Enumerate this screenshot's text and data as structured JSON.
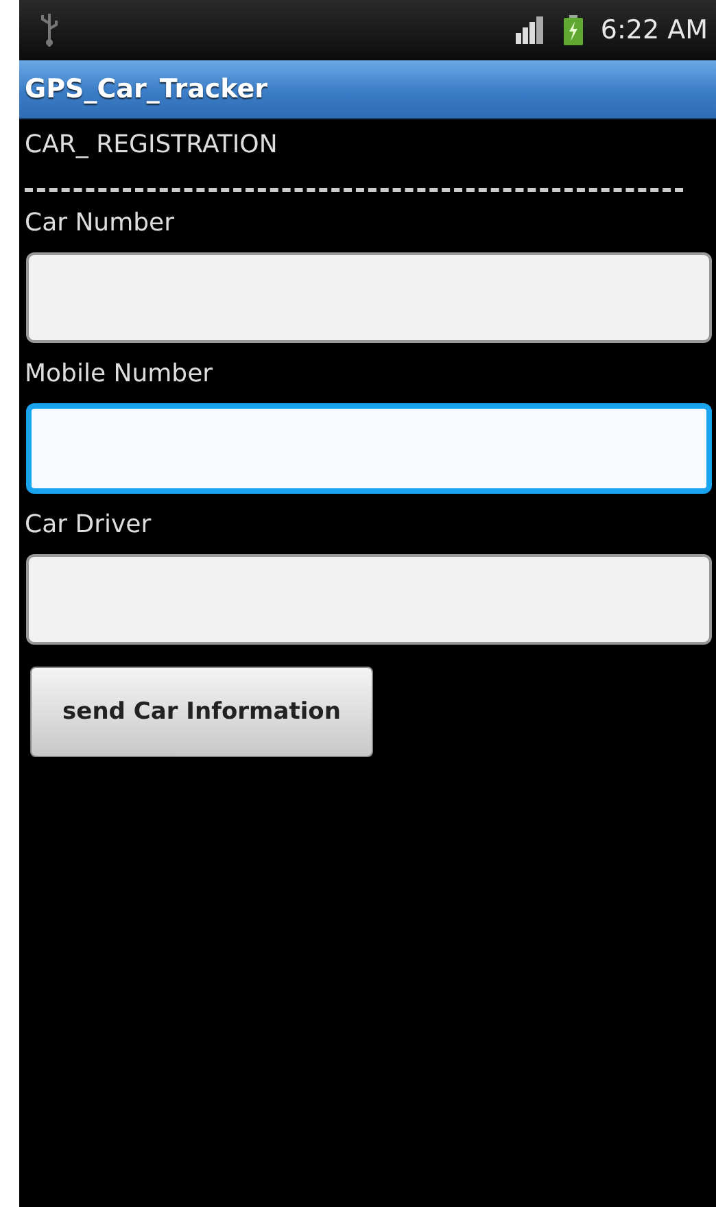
{
  "status_bar": {
    "time": "6:22 AM"
  },
  "app_bar": {
    "title": "GPS_Car_Tracker"
  },
  "heading": "CAR_ REGISTRATION",
  "fields": [
    {
      "label": "Car Number",
      "focused": false
    },
    {
      "label": "Mobile Number",
      "focused": true
    },
    {
      "label": "Car Driver",
      "focused": false
    }
  ],
  "button": "send Car Information"
}
